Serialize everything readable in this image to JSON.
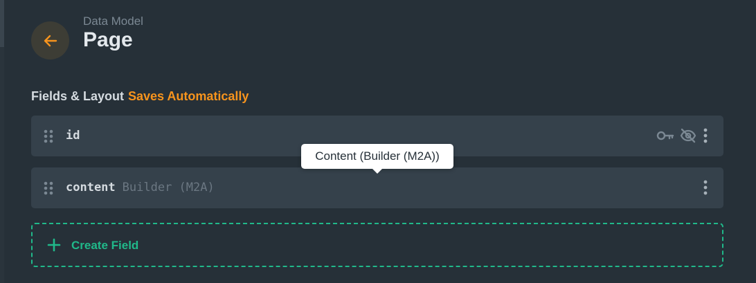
{
  "header": {
    "breadcrumb": "Data Model",
    "title": "Page"
  },
  "section": {
    "title": "Fields & Layout",
    "status": "Saves Automatically"
  },
  "fields": [
    {
      "name": "id",
      "type": "",
      "icons": [
        "key-icon",
        "eye-off-icon",
        "more-vertical-icon"
      ]
    },
    {
      "name": "content",
      "type": "Builder (M2A)",
      "icons": [
        "more-vertical-icon"
      ]
    }
  ],
  "create_field": {
    "label": "Create Field"
  },
  "tooltip": {
    "text": "Content (Builder (M2A))"
  },
  "colors": {
    "background": "#263038",
    "row": "#35414b",
    "accent_orange": "#f7941d",
    "accent_green": "#20b98a",
    "muted_text": "#6b7782"
  }
}
